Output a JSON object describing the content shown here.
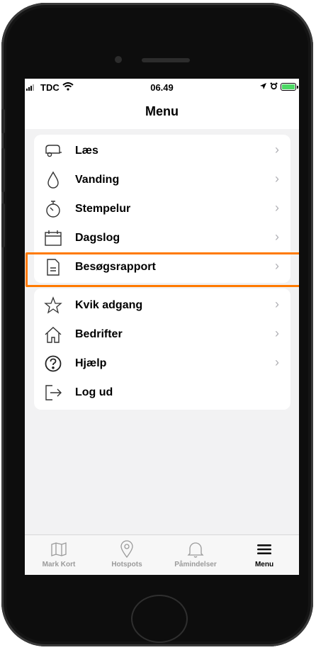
{
  "status_bar": {
    "carrier": "TDC",
    "time": "06.49"
  },
  "nav": {
    "title": "Menu"
  },
  "menu_group1": [
    {
      "label": "Læs",
      "icon": "trailer-icon"
    },
    {
      "label": "Vanding",
      "icon": "water-drop-icon"
    },
    {
      "label": "Stempelur",
      "icon": "stopwatch-icon"
    },
    {
      "label": "Dagslog",
      "icon": "calendar-icon"
    },
    {
      "label": "Besøgsrapport",
      "icon": "document-icon"
    }
  ],
  "menu_group2": [
    {
      "label": "Kvik adgang",
      "icon": "star-icon"
    },
    {
      "label": "Bedrifter",
      "icon": "home-icon"
    },
    {
      "label": "Hjælp",
      "icon": "help-icon"
    },
    {
      "label": "Log ud",
      "icon": "logout-icon"
    }
  ],
  "tabs": [
    {
      "label": "Mark Kort",
      "icon": "map-icon"
    },
    {
      "label": "Hotspots",
      "icon": "location-pin-icon"
    },
    {
      "label": "Påmindelser",
      "icon": "bell-icon"
    },
    {
      "label": "Menu",
      "icon": "hamburger-icon",
      "active": true
    }
  ],
  "colors": {
    "highlight": "#ff7a00",
    "battery": "#4cd964",
    "chevron": "#b0b0b5"
  }
}
